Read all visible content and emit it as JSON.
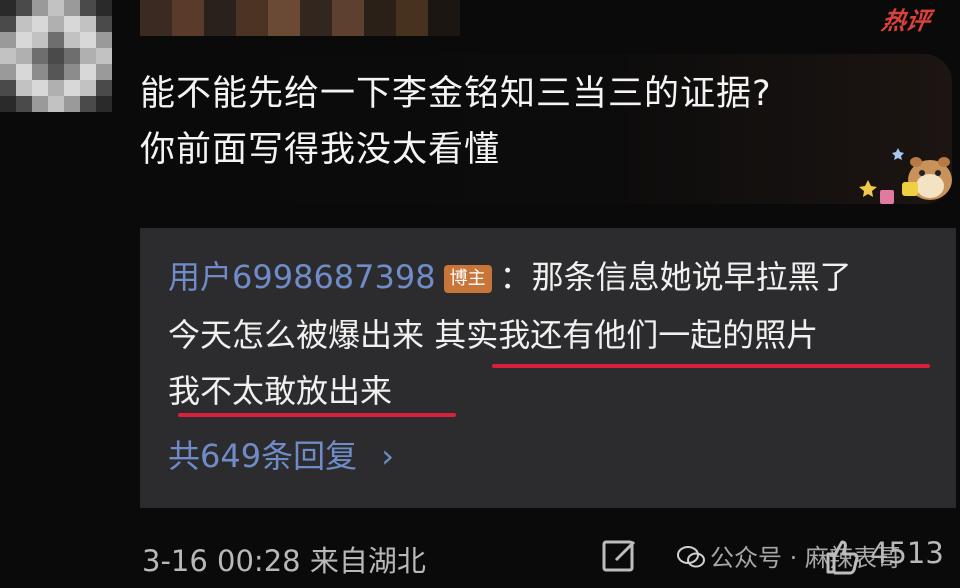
{
  "header": {
    "hot_badge": "热评"
  },
  "comment": {
    "lines": [
      "能不能先给一下李金铭知三当三的证据?",
      "你前面写得我没太看懂"
    ]
  },
  "reply": {
    "username": "用户6998687398",
    "tag": "博主",
    "separator": "：",
    "line1_text": "那条信息她说早拉黑了",
    "line2_plain": "今天怎么被爆出来 ",
    "line2_underlined": "其实我还有他们一起的照片",
    "line3_underlined": "我不太敢放出来",
    "reply_count_label": "共649条回复",
    "chevron": "›"
  },
  "footer": {
    "meta": "3-16 00:28 来自湖北",
    "watermark": "公众号 · 麻辣表哥",
    "like_count": "4513"
  },
  "colors": {
    "link_blue": "#6f8cc8",
    "underline_red": "#d8203a",
    "blogger_tag_bg": "#c8753a",
    "hot_red": "#d9423a"
  },
  "icons": [
    "edit-icon",
    "wechat-logo-icon",
    "like-icon",
    "chevron-right-icon"
  ]
}
